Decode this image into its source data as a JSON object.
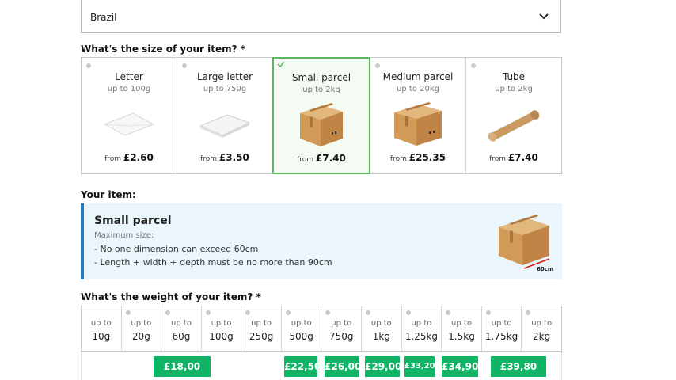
{
  "country": {
    "value": "Brazil"
  },
  "size_section": {
    "heading": "What's the size of your item? *"
  },
  "sizes": [
    {
      "name": "Letter",
      "limit": "up to 100g",
      "from": "from",
      "price": "£2.60",
      "icon": "envelope-icon"
    },
    {
      "name": "Large letter",
      "limit": "up to 750g",
      "from": "from",
      "price": "£3.50",
      "icon": "large-envelope-icon"
    },
    {
      "name": "Small parcel",
      "limit": "up to 2kg",
      "from": "from",
      "price": "£7.40",
      "icon": "small-box-icon",
      "selected": true
    },
    {
      "name": "Medium parcel",
      "limit": "up to 20kg",
      "from": "from",
      "price": "£25.35",
      "icon": "medium-box-icon"
    },
    {
      "name": "Tube",
      "limit": "up to 2kg",
      "from": "from",
      "price": "£7.40",
      "icon": "tube-icon"
    }
  ],
  "item": {
    "heading": "Your item:",
    "title": "Small parcel",
    "subtitle": "Maximum size:",
    "rules": [
      "- No one dimension can exceed 60cm",
      "- Length + width + depth must be no more than 90cm"
    ],
    "dimension_label": "60cm"
  },
  "weight_section": {
    "heading": "What's the weight of your item? *"
  },
  "weights": [
    {
      "up": "up to",
      "amount": "10g"
    },
    {
      "up": "up to",
      "amount": "20g"
    },
    {
      "up": "up to",
      "amount": "60g"
    },
    {
      "up": "up to",
      "amount": "100g"
    },
    {
      "up": "up to",
      "amount": "250g"
    },
    {
      "up": "up to",
      "amount": "500g"
    },
    {
      "up": "up to",
      "amount": "750g"
    },
    {
      "up": "up to",
      "amount": "1kg"
    },
    {
      "up": "up to",
      "amount": "1.25kg"
    },
    {
      "up": "up to",
      "amount": "1.5kg"
    },
    {
      "up": "up to",
      "amount": "1.75kg"
    },
    {
      "up": "up to",
      "amount": "2kg"
    }
  ],
  "prices": [
    "£18,00",
    "£22,50",
    "£26,00",
    "£29,00",
    "£33,20",
    "£34,90",
    "£39,80"
  ],
  "colors": {
    "accent_green": "#0fb465",
    "selected_border": "#5cb85c",
    "info_bar": "#2878c0",
    "info_bg": "#eaf5fc"
  }
}
